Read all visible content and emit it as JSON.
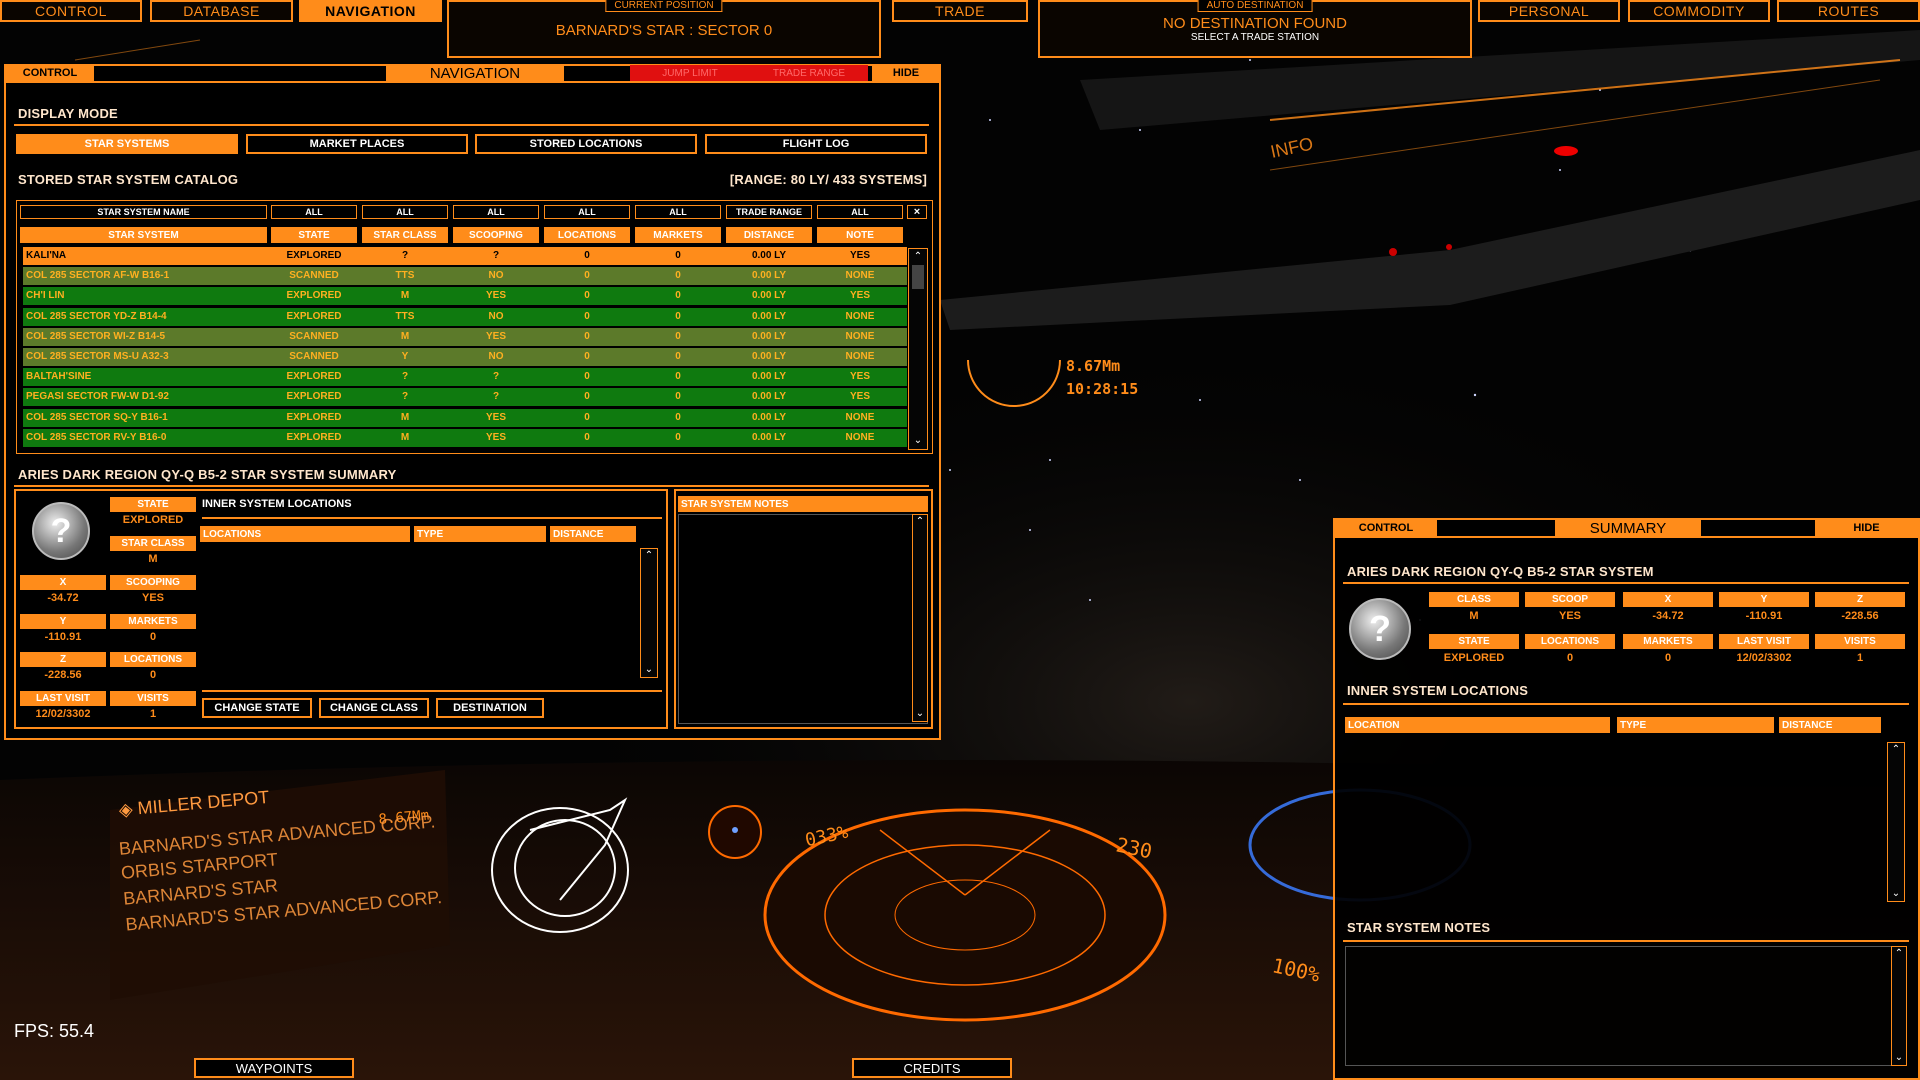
{
  "top_nav": {
    "control": "CONTROL",
    "database": "DATABASE",
    "navigation": "NAVIGATION",
    "trade": "TRADE",
    "personal": "PERSONAL",
    "commodity": "COMMODITY",
    "routes": "ROUTES"
  },
  "current_position": {
    "caption": "CURRENT POSITION",
    "value": "BARNARD'S STAR : SECTOR 0"
  },
  "auto_destination": {
    "caption": "AUTO DESTINATION",
    "value": "NO DESTINATION FOUND",
    "hint": "SELECT A TRADE STATION"
  },
  "nav_panel": {
    "control": "CONTROL",
    "title": "NAVIGATION",
    "jump_limit": "JUMP LIMIT",
    "trade_range": "TRADE RANGE",
    "hide": "HIDE",
    "display_mode": "DISPLAY MODE",
    "tabs": [
      "STAR SYSTEMS",
      "MARKET PLACES",
      "STORED LOCATIONS",
      "FLIGHT LOG"
    ],
    "catalog_title": "STORED STAR SYSTEM CATALOG",
    "catalog_range": "[RANGE: 80 LY/ 433 SYSTEMS]",
    "filters": [
      "STAR SYSTEM NAME",
      "ALL",
      "ALL",
      "ALL",
      "ALL",
      "ALL",
      "TRADE RANGE",
      "ALL"
    ],
    "filter_clear": "×",
    "columns": [
      "STAR SYSTEM",
      "STATE",
      "STAR CLASS",
      "SCOOPING",
      "LOCATIONS",
      "MARKETS",
      "DISTANCE",
      "NOTE"
    ],
    "rows": [
      [
        "KALI'NA",
        "EXPLORED",
        "?",
        "?",
        "0",
        "0",
        "0.00 LY",
        "YES"
      ],
      [
        "COL 285 SECTOR AF-W B16-1",
        "SCANNED",
        "TTS",
        "NO",
        "0",
        "0",
        "0.00 LY",
        "NONE"
      ],
      [
        "CH'I LIN",
        "EXPLORED",
        "M",
        "YES",
        "0",
        "0",
        "0.00 LY",
        "YES"
      ],
      [
        "COL 285 SECTOR YD-Z B14-4",
        "EXPLORED",
        "TTS",
        "NO",
        "0",
        "0",
        "0.00 LY",
        "NONE"
      ],
      [
        "COL 285 SECTOR WI-Z B14-5",
        "SCANNED",
        "M",
        "YES",
        "0",
        "0",
        "0.00 LY",
        "NONE"
      ],
      [
        "COL 285 SECTOR MS-U A32-3",
        "SCANNED",
        "Y",
        "NO",
        "0",
        "0",
        "0.00 LY",
        "NONE"
      ],
      [
        "BALTAH'SINE",
        "EXPLORED",
        "?",
        "?",
        "0",
        "0",
        "0.00 LY",
        "YES"
      ],
      [
        "PEGASI SECTOR FW-W D1-92",
        "EXPLORED",
        "?",
        "?",
        "0",
        "0",
        "0.00 LY",
        "YES"
      ],
      [
        "COL 285 SECTOR SQ-Y B16-1",
        "EXPLORED",
        "M",
        "YES",
        "0",
        "0",
        "0.00 LY",
        "NONE"
      ],
      [
        "COL 285 SECTOR RV-Y B16-0",
        "EXPLORED",
        "M",
        "YES",
        "0",
        "0",
        "0.00 LY",
        "NONE"
      ]
    ],
    "summary_title": "ARIES DARK REGION QY-Q B5-2 STAR SYSTEM SUMMARY",
    "summary": {
      "state_l": "STATE",
      "state_v": "EXPLORED",
      "class_l": "STAR CLASS",
      "class_v": "M",
      "x_l": "X",
      "x_v": "-34.72",
      "scoop_l": "SCOOPING",
      "scoop_v": "YES",
      "y_l": "Y",
      "y_v": "-110.91",
      "markets_l": "MARKETS",
      "markets_v": "0",
      "z_l": "Z",
      "z_v": "-228.56",
      "locations_l": "LOCATIONS",
      "locations_v": "0",
      "lastvisit_l": "LAST VISIT",
      "lastvisit_v": "12/02/3302",
      "visits_l": "VISITS",
      "visits_v": "1"
    },
    "inner_title": "INNER SYSTEM LOCATIONS",
    "inner_cols": [
      "LOCATIONS",
      "TYPE",
      "DISTANCE"
    ],
    "buttons": [
      "CHANGE STATE",
      "CHANGE CLASS",
      "DESTINATION"
    ],
    "notes_title": "STAR SYSTEM NOTES"
  },
  "summary_panel": {
    "control": "CONTROL",
    "title": "SUMMARY",
    "hide": "HIDE",
    "system": "ARIES DARK REGION QY-Q B5-2 STAR SYSTEM",
    "labels1": [
      "CLASS",
      "SCOOP",
      "X",
      "Y",
      "Z"
    ],
    "values1": [
      "M",
      "YES",
      "-34.72",
      "-110.91",
      "-228.56"
    ],
    "labels2": [
      "STATE",
      "LOCATIONS",
      "MARKETS",
      "LAST VISIT",
      "VISITS"
    ],
    "values2": [
      "EXPLORED",
      "0",
      "0",
      "12/02/3302",
      "1"
    ],
    "inner_title": "INNER SYSTEM LOCATIONS",
    "inner_cols": [
      "LOCATION",
      "TYPE",
      "DISTANCE"
    ],
    "notes_title": "STAR SYSTEM NOTES"
  },
  "hud": {
    "distance": "8.67Mm",
    "time": "10:28:15",
    "info": "INFO",
    "target_name": "MILLER DEPOT",
    "target_dist": "8.67Mm",
    "list": [
      "BARNARD'S STAR ADVANCED CORP.",
      "ORBIS STARPORT",
      "BARNARD'S STAR",
      "BARNARD'S STAR ADVANCED CORP."
    ],
    "throttle": "033%",
    "speed": "230",
    "fuel_pct": "100%",
    "fps": "FPS: 55.4",
    "waypoints": "WAYPOINTS",
    "credits": "CREDITS"
  },
  "colors": {
    "accent": "#ff8c1a",
    "row_explored": "#0f7a0f",
    "row_scanned": "#5c7a2a",
    "row_selected": "#ff8c1a"
  }
}
